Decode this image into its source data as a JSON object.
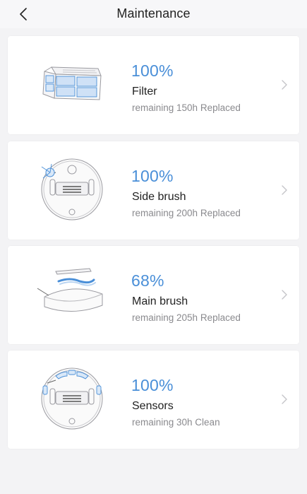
{
  "header": {
    "title": "Maintenance",
    "back_icon": "chevron-left-icon"
  },
  "colors": {
    "accent": "#4a8fd8",
    "background": "#f3f3f5",
    "card": "#ffffff"
  },
  "items": [
    {
      "percent": "100%",
      "name": "Filter",
      "detail": "remaining 150h Replaced",
      "icon": "filter-icon"
    },
    {
      "percent": "100%",
      "name": "Side brush",
      "detail": "remaining 200h Replaced",
      "icon": "side-brush-icon"
    },
    {
      "percent": "68%",
      "name": "Main brush",
      "detail": "remaining 205h Replaced",
      "icon": "main-brush-icon"
    },
    {
      "percent": "100%",
      "name": "Sensors",
      "detail": "remaining 30h Clean",
      "icon": "sensors-icon"
    }
  ]
}
